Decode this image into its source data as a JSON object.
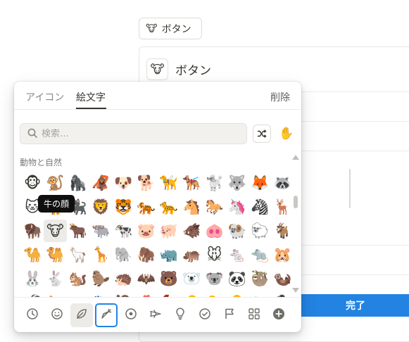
{
  "background": {
    "button_emoji": "🐮",
    "button_label": "ボタン",
    "card_title": "ボタン",
    "done_label": "完了"
  },
  "picker": {
    "tabs": {
      "icons": "アイコン",
      "emoji": "絵文字",
      "remove": "削除"
    },
    "search": {
      "placeholder": "検索…",
      "value": ""
    },
    "skin_tone": "✋",
    "category_label": "動物と自然",
    "tooltip": "牛の顔",
    "rows": [
      [
        "🐵",
        "🐒",
        "🦍",
        "🦧",
        "🐶",
        "🐕",
        "🦮",
        "🐕‍🦺",
        "🐩",
        "🐺",
        "🦊",
        "🦝"
      ],
      [
        "🐱",
        "🐈",
        "🐈‍⬛",
        "🦁",
        "🐯",
        "🐅",
        "🐆",
        "🐴",
        "🐎",
        "🦄",
        "🦓",
        "🦌"
      ],
      [
        "🦬",
        "🐮",
        "🐂",
        "🐃",
        "🐄",
        "🐷",
        "🐖",
        "🐗",
        "🐽",
        "🐏",
        "🐑",
        "🐐"
      ],
      [
        "🐪",
        "🐫",
        "🦙",
        "🦒",
        "🐘",
        "🦣",
        "🦏",
        "🦛",
        "🐭",
        "🐁",
        "🐀",
        "🐹"
      ],
      [
        "🐰",
        "🐇",
        "🐿️",
        "🦫",
        "🦔",
        "🦇",
        "🐻",
        "🐻‍❄️",
        "🐨",
        "🐼",
        "🦥",
        "🦦"
      ],
      [
        "🦨",
        "🦘",
        "🦡",
        "🐾",
        "🦃",
        "🐔",
        "🐓",
        "🐣",
        "🐤",
        "🐥",
        "🐦",
        "🐧"
      ]
    ],
    "highlighted_emoji": "🐮",
    "bottom_categories": [
      {
        "name": "recent",
        "label": "最近"
      },
      {
        "name": "smileys",
        "label": "スマイリー"
      },
      {
        "name": "nature-leaf",
        "label": "葉"
      },
      {
        "name": "food",
        "label": "食べ物"
      },
      {
        "name": "activity",
        "label": "アクティビティ"
      },
      {
        "name": "travel",
        "label": "旅行"
      },
      {
        "name": "objects",
        "label": "物"
      },
      {
        "name": "symbols",
        "label": "記号"
      },
      {
        "name": "flags",
        "label": "旗"
      },
      {
        "name": "grid",
        "label": "その他"
      },
      {
        "name": "custom",
        "label": "追加"
      }
    ],
    "active_category": "food"
  },
  "colors": {
    "accent": "#2383e2",
    "text": "#37352f",
    "muted": "#8a8985"
  }
}
